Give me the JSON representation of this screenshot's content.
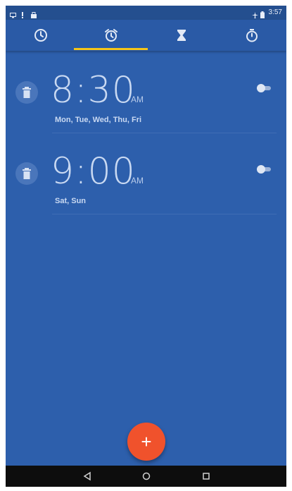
{
  "status_bar": {
    "left_icons": [
      "screen-icon",
      "signal-icon",
      "bag-icon"
    ],
    "right_icons": [
      "airplane-icon",
      "battery-icon"
    ],
    "time": "3:57"
  },
  "tabs": [
    {
      "name": "clock-icon"
    },
    {
      "name": "alarm-icon",
      "active": true
    },
    {
      "name": "timer-icon"
    },
    {
      "name": "stopwatch-icon"
    }
  ],
  "alarms": [
    {
      "time": "8:30",
      "ampm": "AM",
      "days": "Mon, Tue, Wed, Thu, Fri",
      "enabled": false
    },
    {
      "time": "9:00",
      "ampm": "AM",
      "days": "Sat, Sun",
      "enabled": false
    }
  ],
  "fab": {
    "label": "+"
  },
  "nav": [
    "back-icon",
    "home-icon",
    "recents-icon"
  ],
  "colors": {
    "background": "#2d5fac",
    "accent": "#f5c518",
    "fab": "#f0522c"
  }
}
